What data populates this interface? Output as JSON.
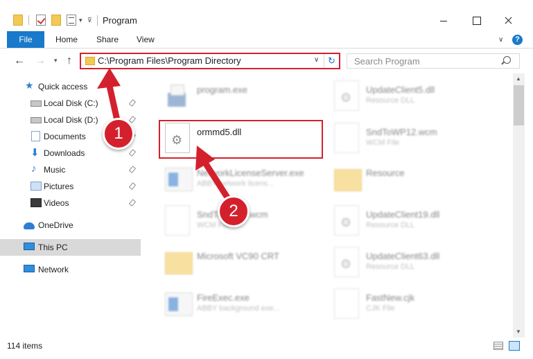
{
  "window": {
    "title": "Program"
  },
  "ribbon": {
    "file": "File",
    "home": "Home",
    "share": "Share",
    "view": "View",
    "help": "?"
  },
  "address": {
    "path": "C:\\Program Files\\Program Directory"
  },
  "search": {
    "placeholder": "Search Program"
  },
  "nav": {
    "items": [
      {
        "label": "Quick access",
        "icon": "star-icon"
      },
      {
        "label": "Local Disk (C:)",
        "icon": "drive-icon",
        "pinned": true
      },
      {
        "label": "Local Disk (D:)",
        "icon": "drive-icon",
        "pinned": true
      },
      {
        "label": "Documents",
        "icon": "documents-icon",
        "pinned": true
      },
      {
        "label": "Downloads",
        "icon": "download-icon",
        "pinned": true
      },
      {
        "label": "Music",
        "icon": "music-icon",
        "pinned": true
      },
      {
        "label": "Pictures",
        "icon": "pictures-icon",
        "pinned": true
      },
      {
        "label": "Videos",
        "icon": "video-icon",
        "pinned": true
      },
      {
        "label": "OneDrive",
        "icon": "cloud-icon"
      },
      {
        "label": "This PC",
        "icon": "computer-icon",
        "selected": true
      },
      {
        "label": "Network",
        "icon": "network-icon"
      }
    ]
  },
  "files": [
    {
      "name": "program.exe",
      "desc": ""
    },
    {
      "name": "UpdateClient5.dll",
      "desc": "Resource DLL"
    },
    {
      "name": "ormmd5.dll",
      "desc": ""
    },
    {
      "name": "SndToWP12.wcm",
      "desc": "WCM File"
    },
    {
      "name": "NetworkLicenseServer.exe",
      "desc": "ABBY network licens..."
    },
    {
      "name": "Resource",
      "desc": ""
    },
    {
      "name": "SndToWP13.wcm",
      "desc": "WCM File"
    },
    {
      "name": "UpdateClient19.dll",
      "desc": "Resource DLL"
    },
    {
      "name": "Microsoft VC90 CRT",
      "desc": ""
    },
    {
      "name": "UpdateClient63.dll",
      "desc": "Resource DLL"
    },
    {
      "name": "FireExec.exe",
      "desc": "ABBY background exe..."
    },
    {
      "name": "FastNew.cjk",
      "desc": "CJK File"
    }
  ],
  "status": {
    "items": "114 items"
  },
  "callouts": {
    "one": "1",
    "two": "2"
  },
  "colors": {
    "accent": "#1979ca",
    "highlight": "#d4202d"
  }
}
